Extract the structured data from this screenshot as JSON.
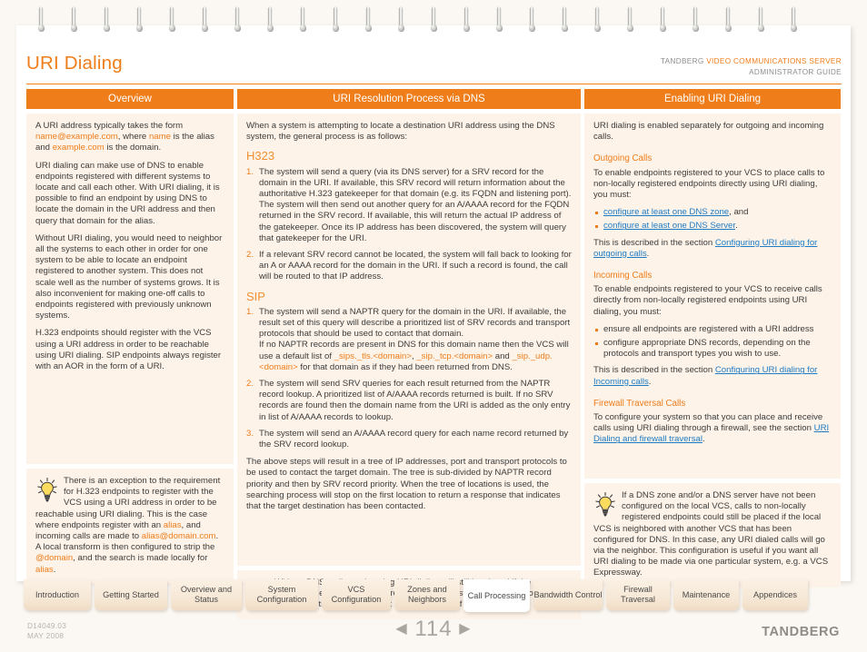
{
  "header": {
    "title": "URI Dialing",
    "brand_prefix": "TANDBERG ",
    "brand_product": "VIDEO COMMUNICATIONS SERVER",
    "brand_sub": "ADMINISTRATOR GUIDE"
  },
  "columns": {
    "overview": {
      "banner": "Overview",
      "p1_a": "A URI address typically takes the form ",
      "p1_b": "name@example.com",
      "p1_c": ", where ",
      "p1_d": "name",
      "p1_e": " is the alias and ",
      "p1_f": "example.com",
      "p1_g": " is the domain.",
      "p2": "URI dialing can make use of DNS to enable endpoints registered with different systems to locate and call each other. With URI dialing, it is possible to find an endpoint by using DNS to locate the domain in the URI address and then query that domain for the alias.",
      "p3": "Without URI dialing, you would need to neighbor all the systems to each other in order for one system to be able to locate an endpoint registered to another system. This does not scale well as the number of systems grows. It is also inconvenient for making one-off calls to endpoints registered with previously unknown systems.",
      "p4": "H.323 endpoints should register with the VCS using a URI address in order to be reachable using URI dialing.  SIP endpoints always register with an AOR in the form of a URI.",
      "tip_a": "There is an exception to the requirement for H.323 endpoints to register with the VCS using a URI address in order to be reachable using URI dialing.  This is the case where endpoints register with an ",
      "tip_b": "alias",
      "tip_c": ", and incoming calls are made to ",
      "tip_d": "alias@domain.com",
      "tip_e": ".  A local transform is then configured to strip the ",
      "tip_f": "@domain",
      "tip_g": ", and the search is made locally for ",
      "tip_h": "alias",
      "tip_i": "."
    },
    "resolution": {
      "banner": "URI Resolution Process via DNS",
      "intro": "When a system is attempting to locate a destination URI address using the DNS system, the general process is as follows:",
      "h323_heading": "H323",
      "h323_steps": [
        "The system will send a query (via its DNS server) for a SRV record for the domain in the URI. If available, this SRV record will return information about the authoritative H.323 gatekeeper for that domain (e.g. its FQDN and listening port).\nThe system will then send out another query for an A/AAAA record for the FQDN returned in the SRV record. If available, this will return the actual IP address of the gatekeeper. Once its IP address has been discovered, the system will query that gatekeeper for the URI.",
        "If a relevant SRV record cannot be located, the system will fall back to looking for an A or AAAA record for the domain in the URI. If such a record is found, the call will be routed to that IP address."
      ],
      "sip_heading": "SIP",
      "sip_step1_a": "The system will send a NAPTR query for the domain in the URI. If available, the result set of this query will describe a prioritized list of SRV records and transport protocols that should be used to contact that domain.",
      "sip_step1_b": "If no NAPTR records are present in DNS for this domain name then the VCS will use a default list of ",
      "sip_step1_c": "_sips._tls.<domain>",
      "sip_step1_d": ", ",
      "sip_step1_e": "_sip._tcp.<domain>",
      "sip_step1_f": " and ",
      "sip_step1_g": "_sip._udp.<domain>",
      "sip_step1_h": " for that domain as if they had been returned from DNS.",
      "sip_step2": "The system will send SRV queries for each result returned from the NAPTR record lookup. A prioritized list of A/AAAA records returned is built. If no SRV records are found then the domain name from the URI is added as the only entry in list of A/AAAA records to lookup.",
      "sip_step3": "The system will send an A/AAAA record query for each name record returned by the SRV record lookup.",
      "closing": "The above steps will result in a tree of IP addresses, port and transport protocols to be used to contact the target domain. The tree is sub-divided by NAPTR record priority and then by SRV record priority. When the tree of locations is used, the searching process will stop on the first location to return a response that indicates that the target destination has been contacted.",
      "tip": "Without DNS, calls made using URI dialing will still be placed if the destination endpoint is locally registered, or registered to a neighbor system as locating these this does not require the use of DNS."
    },
    "enabling": {
      "banner": "Enabling URI Dialing",
      "intro": "URI dialing is enabled separately for outgoing and incoming calls.",
      "outgoing_heading": "Outgoing Calls",
      "outgoing_p": "To enable endpoints registered to your VCS to place calls to non-locally registered endpoints directly using URI dialing, you must:",
      "outgoing_bullets": [
        {
          "link": "configure at least one DNS zone",
          "tail": ", and"
        },
        {
          "link": "configure at least one DNS Server",
          "tail": "."
        }
      ],
      "outgoing_ref_a": "This is described in the section ",
      "outgoing_ref_link": "Configuring URI dialing for outgoing calls",
      "outgoing_ref_b": ".",
      "incoming_heading": "Incoming Calls",
      "incoming_p": "To enable endpoints registered to your VCS to receive calls directly from non-locally registered endpoints using URI dialing, you must:",
      "incoming_bullets": [
        {
          "link": "",
          "tail": "ensure all endpoints are registered with a URI address"
        },
        {
          "link": "",
          "tail": "configure appropriate DNS records, depending on the protocols and transport types you wish to use."
        }
      ],
      "incoming_ref_a": "This is described in the section ",
      "incoming_ref_link": "Configuring URI dialing for Incoming calls",
      "incoming_ref_b": ".",
      "firewall_heading": "Firewall Traversal Calls",
      "firewall_a": "To configure your system so that you can place and receive calls using URI dialing through a firewall, see the section ",
      "firewall_link": "URI Dialing and firewall traversal",
      "firewall_b": ".",
      "tip": "If a DNS zone and/or a DNS server have not been configured on the local VCS, calls to non-locally registered endpoints could still be placed if the local VCS is neighbored with another VCS that has been configured for DNS. In this case, any URI dialed calls will go via the neighbor. This configuration is useful if you want all URI dialing to be made via one particular system, e.g. a VCS Expressway."
    }
  },
  "tabs": [
    {
      "label": "Introduction",
      "active": false
    },
    {
      "label": "Getting Started",
      "active": false
    },
    {
      "label": "Overview and Status",
      "active": false
    },
    {
      "label": "System Configuration",
      "active": false
    },
    {
      "label": "VCS Configuration",
      "active": false
    },
    {
      "label": "Zones and Neighbors",
      "active": false
    },
    {
      "label": "Call Processing",
      "active": true
    },
    {
      "label": "Bandwidth Control",
      "active": false
    },
    {
      "label": "Firewall Traversal",
      "active": false
    },
    {
      "label": "Maintenance",
      "active": false
    },
    {
      "label": "Appendices",
      "active": false
    }
  ],
  "footer": {
    "doc_id": "D14049.03",
    "doc_date": "MAY 2008",
    "page_number": "114",
    "prev_arrow": "◀",
    "next_arrow": "▶",
    "logo": "TANDBERG"
  },
  "colors": {
    "accent": "#ef7d1a",
    "panel_bg": "#fdf3e9",
    "link": "#1f7bc4",
    "page_bg": "#fbf8f3"
  }
}
